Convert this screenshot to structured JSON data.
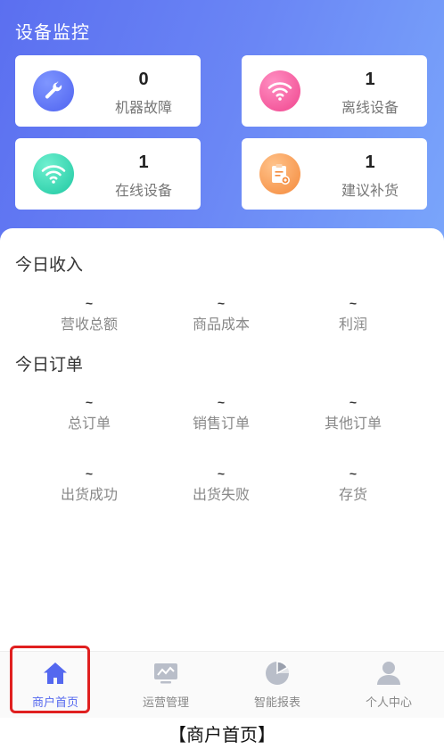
{
  "header": {
    "title": "设备监控"
  },
  "cards": [
    {
      "value": "0",
      "label": "机器故障",
      "icon": "wrench-icon",
      "color": "#5a6ff2"
    },
    {
      "value": "1",
      "label": "离线设备",
      "icon": "wifi-icon",
      "color": "#f2539a"
    },
    {
      "value": "1",
      "label": "在线设备",
      "icon": "wifi-icon",
      "color": "#2ccfaa"
    },
    {
      "value": "1",
      "label": "建议补货",
      "icon": "clipboard-icon",
      "color": "#f59347"
    }
  ],
  "income": {
    "title": "今日收入",
    "items": [
      {
        "value": "~",
        "label": "营收总额"
      },
      {
        "value": "~",
        "label": "商品成本"
      },
      {
        "value": "~",
        "label": "利润"
      }
    ]
  },
  "orders": {
    "title": "今日订单",
    "items": [
      {
        "value": "~",
        "label": "总订单"
      },
      {
        "value": "~",
        "label": "销售订单"
      },
      {
        "value": "~",
        "label": "其他订单"
      },
      {
        "value": "~",
        "label": "出货成功"
      },
      {
        "value": "~",
        "label": "出货失败"
      },
      {
        "value": "~",
        "label": "存货"
      }
    ]
  },
  "tabbar": {
    "active_color": "#5468ef",
    "items": [
      {
        "label": "商户首页",
        "icon": "home-icon",
        "active": true
      },
      {
        "label": "运营管理",
        "icon": "monitor-chart-icon",
        "active": false
      },
      {
        "label": "智能报表",
        "icon": "pie-chart-icon",
        "active": false
      },
      {
        "label": "个人中心",
        "icon": "user-icon",
        "active": false
      }
    ]
  },
  "caption": "【商户首页】"
}
